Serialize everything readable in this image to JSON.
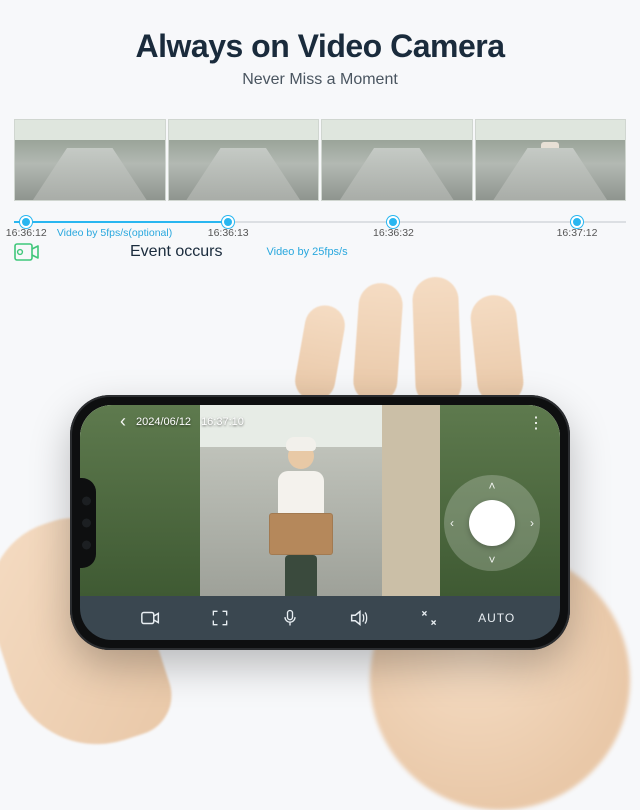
{
  "header": {
    "title": "Always on Video Camera",
    "subtitle": "Never Miss a Moment"
  },
  "timeline": {
    "low_fps_note": "Video by 5fps/s(optional)",
    "high_fps_note": "Video by 25fps/s",
    "event_label": "Event occurs",
    "ticks": [
      {
        "pos": 2,
        "label": "16:36:12"
      },
      {
        "pos": 35,
        "label": "16:36:13"
      },
      {
        "pos": 62,
        "label": "16:36:32"
      },
      {
        "pos": 92,
        "label": "16:37:12"
      }
    ],
    "progress_pct": 35
  },
  "phone": {
    "overlay": {
      "date": "2024/06/12",
      "time": "16:37:10"
    },
    "controls": {
      "record_label": "record",
      "fullscreen_label": "fullscreen",
      "mic_label": "microphone",
      "speaker_label": "speaker",
      "collapse_label": "collapse",
      "mode_label": "AUTO"
    }
  }
}
